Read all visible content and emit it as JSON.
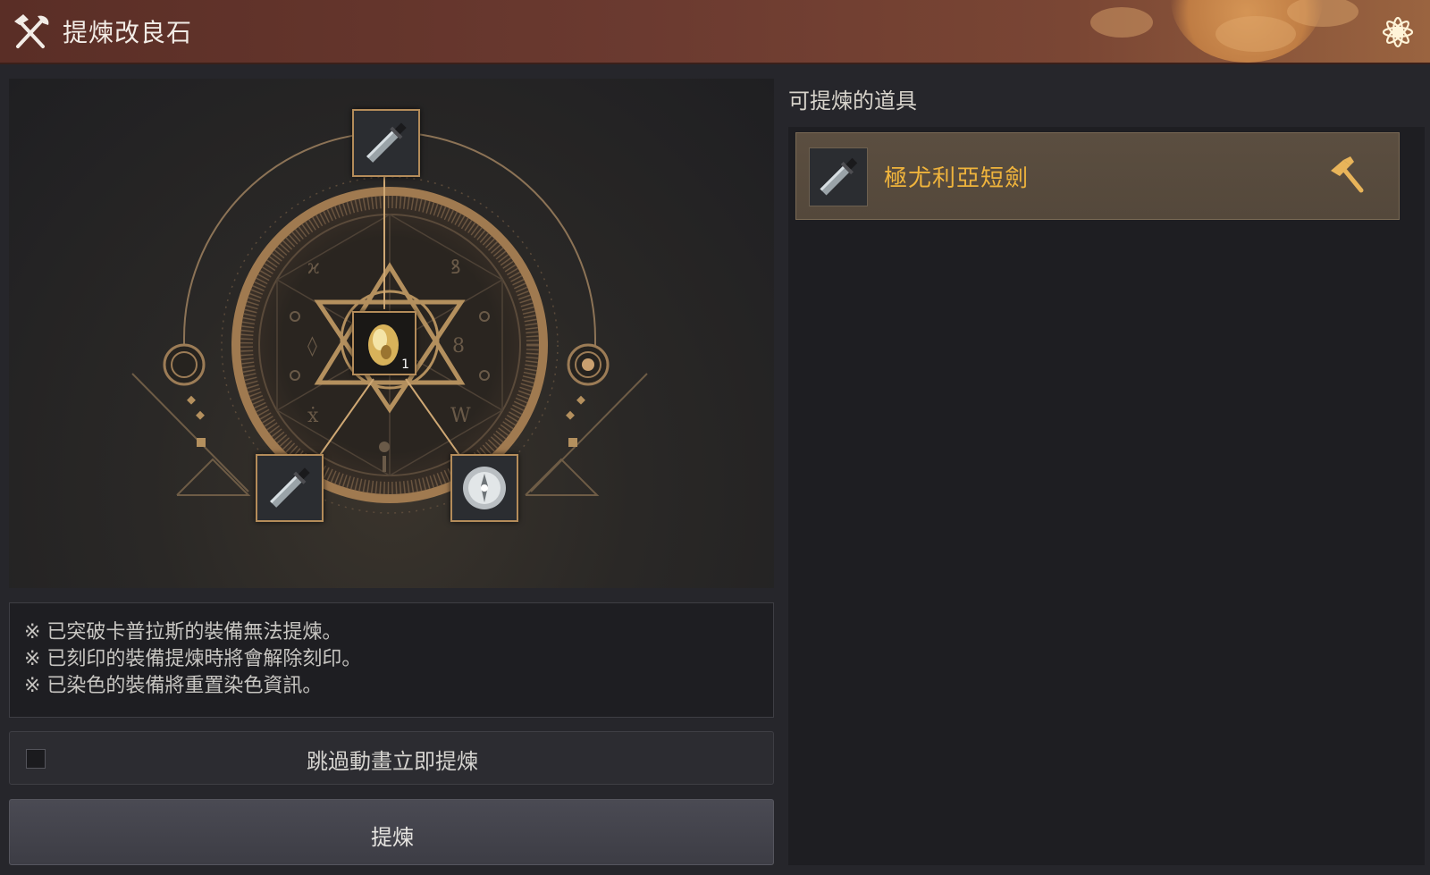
{
  "window": {
    "title": "提煉改良石"
  },
  "craft": {
    "core_count": "1",
    "slots": {
      "top": "dagger-icon",
      "center": "refining-stone-icon",
      "bottom_left": "dagger-icon",
      "bottom_right": "crystal-icon"
    }
  },
  "notes": [
    "※ 已突破卡普拉斯的裝備無法提煉。",
    "※ 已刻印的裝備提煉時將會解除刻印。",
    "※ 已染色的裝備將重置染色資訊。"
  ],
  "skip": {
    "label": "跳過動畫立即提煉",
    "checked": false
  },
  "refine_button": {
    "label": "提煉"
  },
  "item_panel": {
    "title": "可提煉的道具",
    "items": [
      {
        "name": "極尤利亞短劍",
        "icon": "dagger-icon",
        "action_icon": "hammer-icon"
      }
    ]
  },
  "colors": {
    "accent_gold": "#f0b43c",
    "frame_gold": "#b48c5a",
    "titlebar": "#6b3a30"
  }
}
